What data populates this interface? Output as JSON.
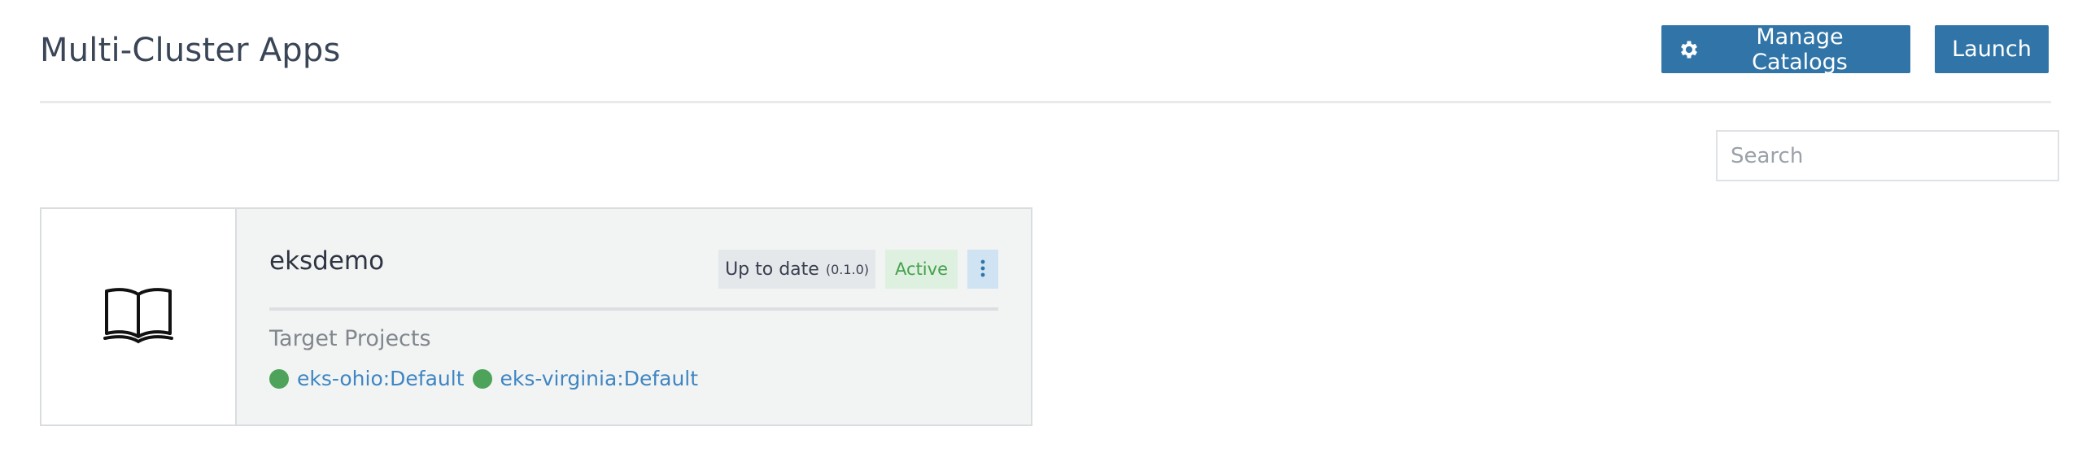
{
  "header": {
    "title": "Multi-Cluster Apps",
    "manage_catalogs_label": "Manage Catalogs",
    "launch_label": "Launch"
  },
  "search": {
    "placeholder": "Search"
  },
  "app_card": {
    "icon": "book-open-icon",
    "name": "eksdemo",
    "status_text": "Up to date",
    "version": "(0.1.0)",
    "state": "Active",
    "target_projects_label": "Target Projects",
    "projects": [
      {
        "name": "eks-ohio:Default",
        "status_color": "#4ea35a"
      },
      {
        "name": "eks-virginia:Default",
        "status_color": "#4ea35a"
      }
    ]
  },
  "colors": {
    "primary_button": "#3175a8",
    "active_text": "#45a04d",
    "active_bg": "#def0df",
    "link": "#3f86c2",
    "menu_button_bg": "#cfe3f2"
  }
}
